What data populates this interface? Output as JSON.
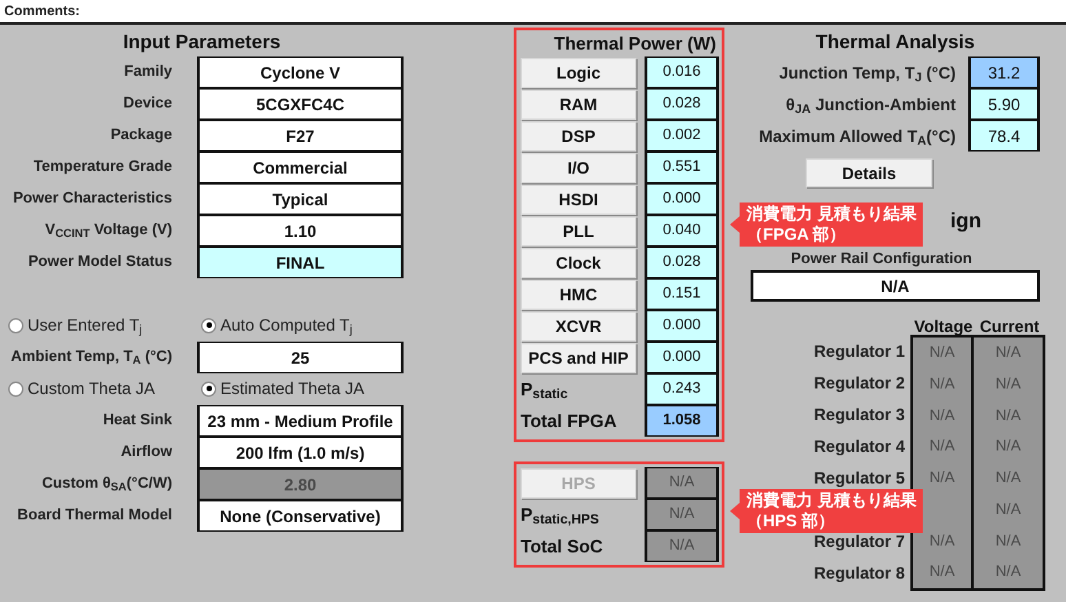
{
  "comments_label": "Comments:",
  "input_parameters": {
    "title": "Input Parameters",
    "device_rows": [
      {
        "label": "Family",
        "value": "Cyclone V",
        "kind": "input"
      },
      {
        "label": "Device",
        "value": "5CGXFC4C",
        "kind": "input"
      },
      {
        "label": "Package",
        "value": "F27",
        "kind": "input"
      },
      {
        "label": "Temperature Grade",
        "value": "Commercial",
        "kind": "input"
      },
      {
        "label": "Power Characteristics",
        "value": "Typical",
        "kind": "input"
      },
      {
        "label": "V$_{CCINT}$ Voltage (V)",
        "value": "1.10",
        "kind": "input"
      },
      {
        "label": "Power Model Status",
        "value": "FINAL",
        "kind": "result"
      }
    ],
    "tj_mode": [
      {
        "label": "User Entered T$_{j}$",
        "selected": false
      },
      {
        "label": "Auto Computed T$_{j}$",
        "selected": true
      }
    ],
    "ambient": {
      "label": "Ambient Temp, T$_{A}$ (°C)",
      "value": "25"
    },
    "theta_mode": [
      {
        "label": "Custom Theta JA",
        "selected": false
      },
      {
        "label": "Estimated Theta JA",
        "selected": true
      }
    ],
    "cooling_rows": [
      {
        "label": "Heat Sink",
        "value": "23 mm - Medium Profile",
        "kind": "input"
      },
      {
        "label": "Airflow",
        "value": "200 lfm (1.0 m/s)",
        "kind": "input"
      },
      {
        "label": "Custom θ$_{SA}$(°C/W)",
        "value": "2.80",
        "kind": "disabled"
      },
      {
        "label": "Board Thermal Model",
        "value": "None (Conservative)",
        "kind": "input"
      }
    ]
  },
  "thermal_power": {
    "title": "Thermal Power (W)",
    "rows": [
      {
        "label": "Logic",
        "value": "0.016",
        "kind": "button"
      },
      {
        "label": "RAM",
        "value": "0.028",
        "kind": "button"
      },
      {
        "label": "DSP",
        "value": "0.002",
        "kind": "button"
      },
      {
        "label": "I/O",
        "value": "0.551",
        "kind": "button"
      },
      {
        "label": "HSDI",
        "value": "0.000",
        "kind": "button"
      },
      {
        "label": "PLL",
        "value": "0.040",
        "kind": "button"
      },
      {
        "label": "Clock",
        "value": "0.028",
        "kind": "button"
      },
      {
        "label": "HMC",
        "value": "0.151",
        "kind": "button"
      },
      {
        "label": "XCVR",
        "value": "0.000",
        "kind": "button"
      },
      {
        "label": "PCS and HIP",
        "value": "0.000",
        "kind": "button"
      },
      {
        "label": "P$_{static}$",
        "value": "0.243",
        "kind": "text"
      },
      {
        "label": "Total FPGA",
        "value": "1.058",
        "kind": "total"
      }
    ]
  },
  "hps_power": {
    "rows": [
      {
        "label": "HPS",
        "value": "N/A",
        "kind": "button",
        "disabled": true
      },
      {
        "label": "P$_{static,HPS}$",
        "value": "N/A",
        "kind": "text",
        "disabled": true
      },
      {
        "label": "Total SoC",
        "value": "N/A",
        "kind": "text",
        "disabled": true
      }
    ]
  },
  "thermal_analysis": {
    "title": "Thermal Analysis",
    "rows": [
      {
        "label": "Junction Temp, T$_{J}$ (°C)",
        "value": "31.2",
        "kind": "total"
      },
      {
        "label": "θ$_{JA}$ Junction-Ambient",
        "value": "5.90",
        "kind": "result"
      },
      {
        "label": "Maximum Allowed T$_{A}$(°C)",
        "value": "78.4",
        "kind": "result"
      }
    ],
    "details_button": "Details"
  },
  "power_supply": {
    "heading_fragment": "ign",
    "rail_config_label": "Power Rail Configuration",
    "rail_config_value": "N/A",
    "columns": [
      "Voltage",
      "Current"
    ],
    "regulators": [
      {
        "label": "Regulator 1",
        "voltage": "N/A",
        "current": "N/A"
      },
      {
        "label": "Regulator 2",
        "voltage": "N/A",
        "current": "N/A"
      },
      {
        "label": "Regulator 3",
        "voltage": "N/A",
        "current": "N/A"
      },
      {
        "label": "Regulator 4",
        "voltage": "N/A",
        "current": "N/A"
      },
      {
        "label": "Regulator 5",
        "voltage": "N/A",
        "current": "N/A"
      },
      {
        "current": "N/A"
      },
      {
        "label": "Regulator 7",
        "voltage": "N/A",
        "current": "N/A"
      },
      {
        "label": "Regulator 8",
        "voltage": "N/A",
        "current": "N/A"
      }
    ]
  },
  "callouts": [
    {
      "lines": [
        "消費電力 見積もり結果",
        "（FPGA 部）"
      ]
    },
    {
      "lines": [
        "消費電力 見積もり結果",
        "（HPS 部）"
      ]
    }
  ]
}
